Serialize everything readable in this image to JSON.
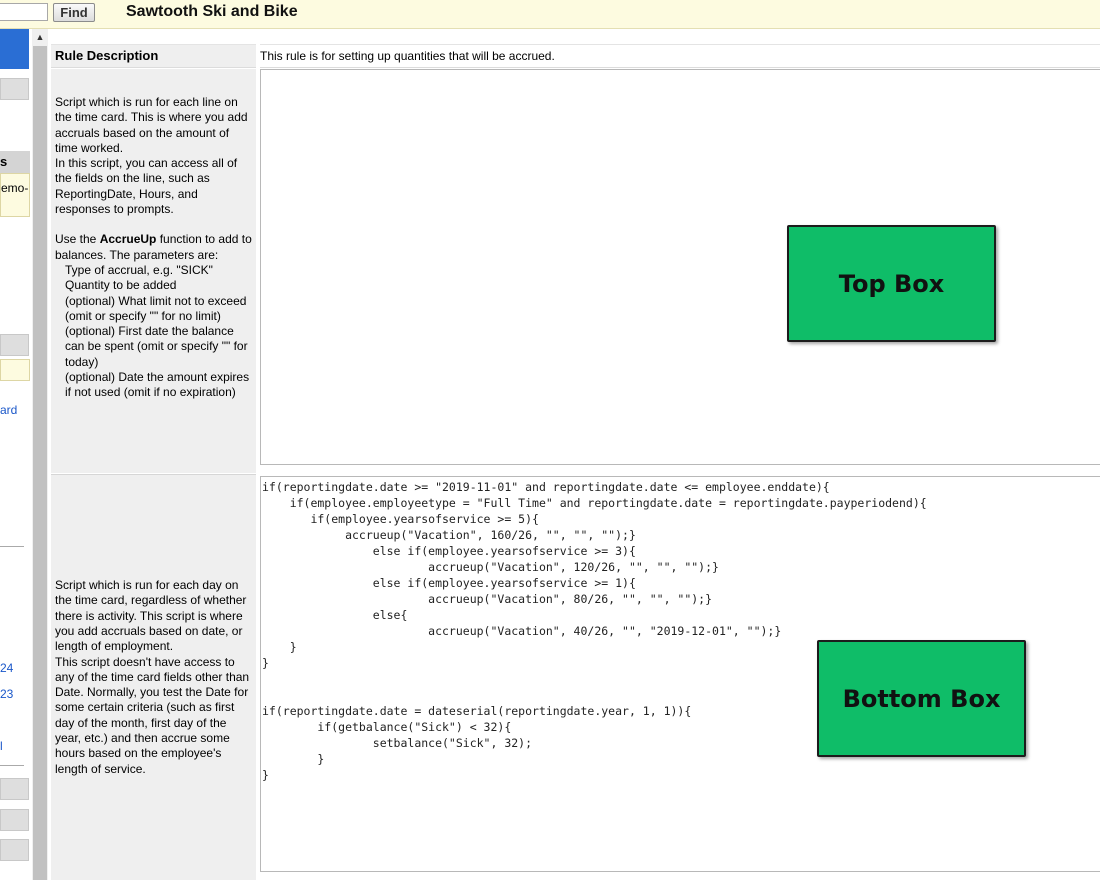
{
  "header": {
    "search_value": "",
    "find_label": "Find",
    "app_title": "Sawtooth Ski and Bike"
  },
  "sidebar": {
    "header_fragment": "s",
    "note_fragment": "emo-",
    "links": [
      "ard",
      "24",
      "23",
      "l"
    ]
  },
  "rule": {
    "description_label": "Rule Description",
    "description_value": "This rule is for setting up quantities that will be accrued."
  },
  "help_top": {
    "intro": "Script which is run for each line on the time card. This is where you add accruals based on the amount of time worked.",
    "intro2": "In this script, you can access all of the fields on the line, such as ReportingDate, Hours, and responses to prompts.",
    "use_prefix": "Use the ",
    "function_name": "AccrueUp",
    "use_suffix": " function to add to balances. The parameters are:",
    "params": [
      "Type of accrual, e.g. \"SICK\"",
      "Quantity to be added",
      "(optional) What limit not to exceed (omit or specify \"\" for no limit)",
      "(optional) First date the balance can be spent (omit or specify \"\" for today)",
      "(optional) Date the amount expires if not used (omit if no expiration)"
    ]
  },
  "help_bottom": {
    "text1": "Script which is run for each day on the time card, regardless of whether there is activity. This script is where you add accruals based on date, or length of employment.",
    "text2": "This script doesn't have access to any of the time card fields other than Date. Normally, you test the Date for some certain criteria (such as first day of the month, first day of the year, etc.) and then accrue some hours based on the employee's length of service."
  },
  "scripts": {
    "top_script": "",
    "bottom_script": "if(reportingdate.date >= \"2019-11-01\" and reportingdate.date <= employee.enddate){\n    if(employee.employeetype = \"Full Time\" and reportingdate.date = reportingdate.payperiodend){\n       if(employee.yearsofservice >= 5){\n            accrueup(\"Vacation\", 160/26, \"\", \"\", \"\");}\n                else if(employee.yearsofservice >= 3){\n                        accrueup(\"Vacation\", 120/26, \"\", \"\", \"\");}\n                else if(employee.yearsofservice >= 1){\n                        accrueup(\"Vacation\", 80/26, \"\", \"\", \"\");}\n                else{\n                        accrueup(\"Vacation\", 40/26, \"\", \"2019-12-01\", \"\");}\n    }\n}\n\n\nif(reportingdate.date = dateserial(reportingdate.year, 1, 1)){\n        if(getbalance(\"Sick\") < 32){\n                setbalance(\"Sick\", 32);\n        }\n}"
  },
  "annotations": {
    "top_box_label": "Top Box",
    "bottom_box_label": "Bottom Box",
    "box_color": "#0fbd68"
  }
}
